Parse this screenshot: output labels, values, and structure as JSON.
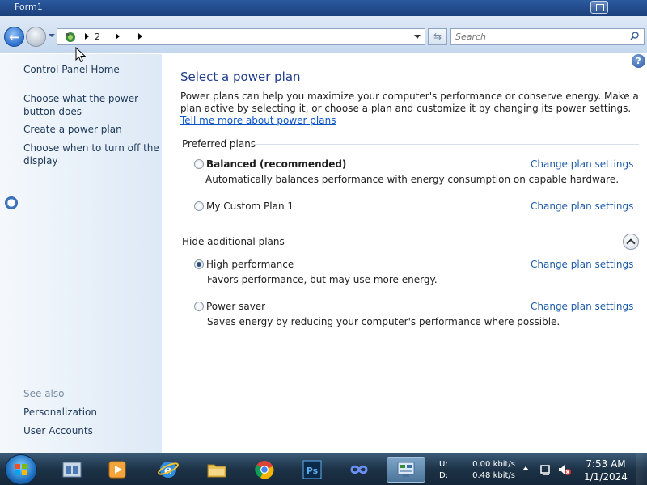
{
  "window": {
    "title": "Form1"
  },
  "address_bar": {
    "breadcrumb": [
      "2"
    ],
    "search_placeholder": "Search"
  },
  "sidebar": {
    "items": [
      {
        "label": "Control Panel Home"
      },
      {
        "label": "Choose what the power button does"
      },
      {
        "label": "Create a power plan"
      },
      {
        "label": "Choose when to turn off the display"
      }
    ],
    "see_also_label": "See also",
    "see_also": [
      {
        "label": "Personalization"
      },
      {
        "label": "User Accounts"
      }
    ]
  },
  "main": {
    "title": "Select a power plan",
    "intro": "Power plans can help you maximize your computer's performance or conserve energy. Make a plan active by selecting it, or choose a plan and customize it by changing its power settings.",
    "intro_link": "Tell me more about power plans",
    "preferred_label": "Preferred plans",
    "additional_label": "Hide additional plans",
    "change_label": "Change plan settings",
    "plans": [
      {
        "name": "Balanced (recommended)",
        "desc": "Automatically balances performance with energy consumption on capable hardware.",
        "selected": false
      },
      {
        "name": "My Custom Plan 1",
        "desc": "",
        "selected": false
      },
      {
        "name": "High performance",
        "desc": "Favors performance, but may use more energy.",
        "selected": true
      },
      {
        "name": "Power saver",
        "desc": "Saves energy by reducing your computer's performance where possible.",
        "selected": false
      }
    ]
  },
  "taskbar": {
    "network": {
      "up_label": "U:",
      "down_label": "D:",
      "up_value": "0.00 kbit/s",
      "down_value": "0.48 kbit/s"
    },
    "clock": {
      "time": "7:53 AM",
      "date": "1/1/2024"
    },
    "apps": [
      {
        "icon": "windows-explorer-icon"
      },
      {
        "icon": "media-player-icon"
      },
      {
        "icon": "internet-explorer-icon"
      },
      {
        "icon": "folder-icon"
      },
      {
        "icon": "chrome-icon"
      },
      {
        "icon": "photoshop-icon"
      },
      {
        "icon": "infinity-app-icon"
      },
      {
        "icon": "control-panel-icon"
      }
    ]
  },
  "colors": {
    "title_blue": "#1e3c8c",
    "link_blue": "#1c5aa6",
    "sidebar_text": "#1e3958"
  }
}
